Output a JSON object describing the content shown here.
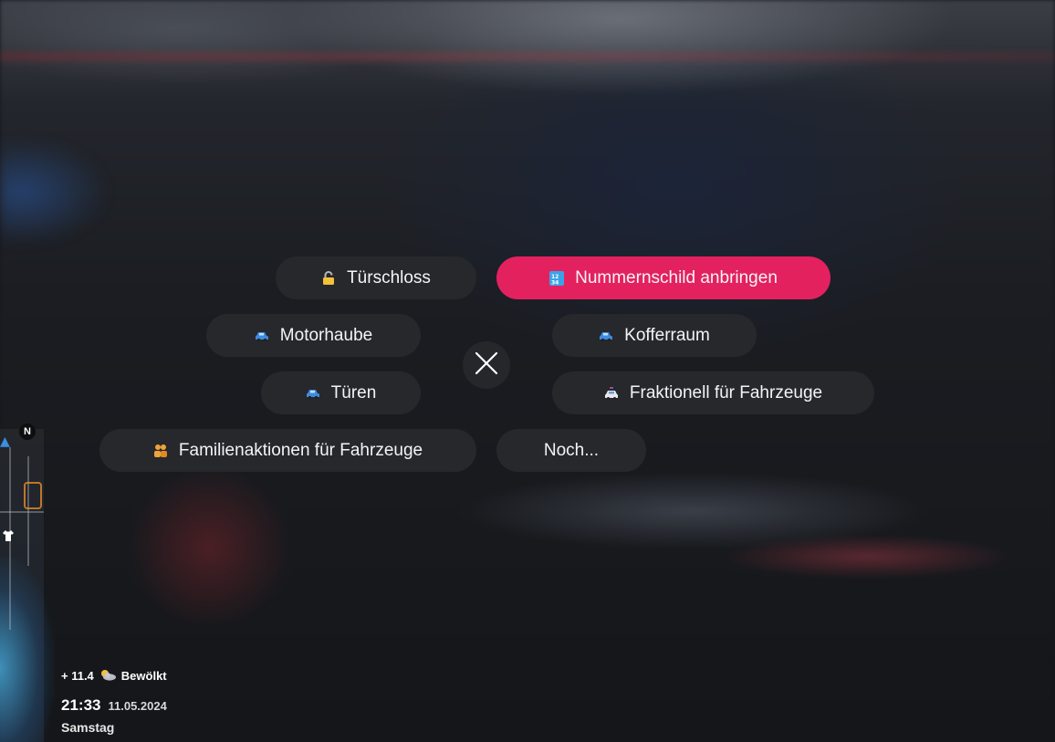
{
  "menu": {
    "items": [
      {
        "key": "door_lock",
        "label": "Türschloss",
        "icon": "padlock-icon",
        "active": false
      },
      {
        "key": "license_plate",
        "label": "Nummernschild anbringen",
        "icon": "numbers-icon",
        "active": true
      },
      {
        "key": "hood",
        "label": "Motorhaube",
        "icon": "car-icon",
        "active": false
      },
      {
        "key": "trunk",
        "label": "Kofferraum",
        "icon": "car-icon",
        "active": false
      },
      {
        "key": "doors",
        "label": "Türen",
        "icon": "car-icon",
        "active": false
      },
      {
        "key": "faction",
        "label": "Fraktionell für Fahrzeuge",
        "icon": "police-car-icon",
        "active": false
      },
      {
        "key": "family",
        "label": "Familienaktionen für Fahrzeuge",
        "icon": "family-icon",
        "active": false
      },
      {
        "key": "more",
        "label": "Noch...",
        "icon": "",
        "active": false
      }
    ],
    "close_icon": "close-icon",
    "active_color": "#e4215f",
    "button_color": "#26282c"
  },
  "hud": {
    "temperature": "+ 11.4",
    "weather_icon": "cloudy-icon",
    "weather": "Bewölkt",
    "time": "21:33",
    "date": "11.05.2024",
    "day": "Samstag",
    "compass": "N"
  }
}
